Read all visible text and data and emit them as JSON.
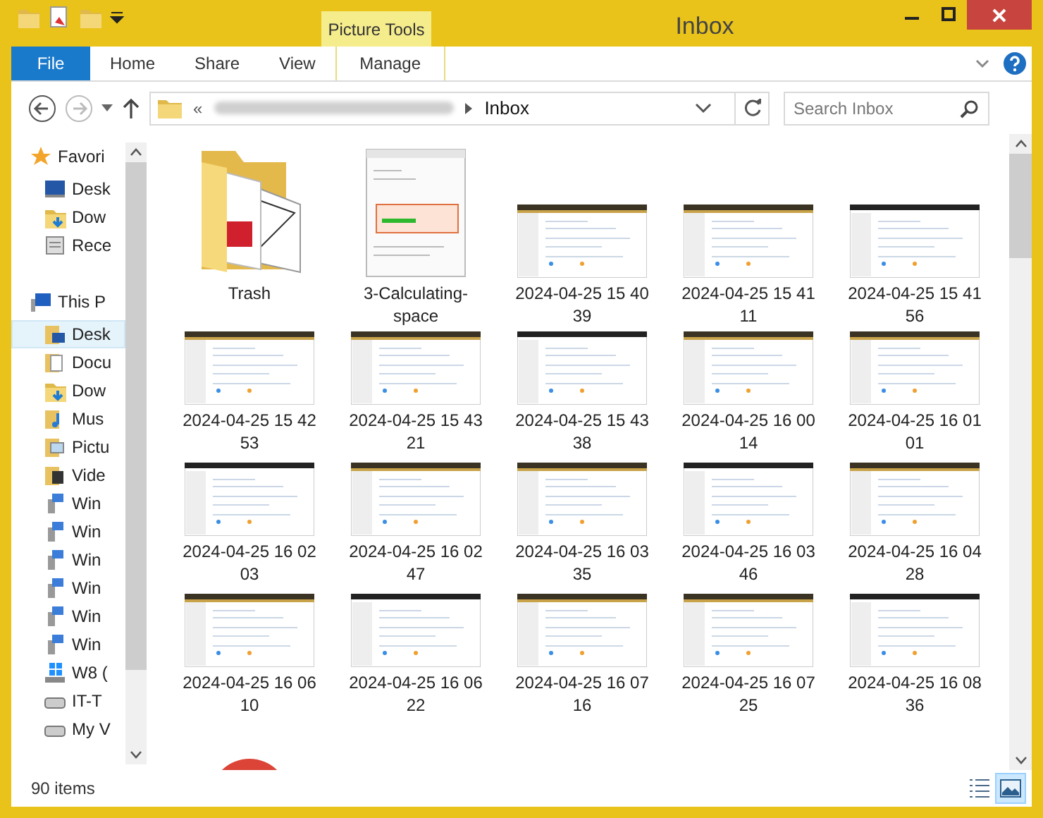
{
  "window": {
    "title": "Inbox",
    "context_tab": "Picture Tools"
  },
  "ribbon": {
    "tabs": [
      {
        "label": "File",
        "kind": "file",
        "selected": false
      },
      {
        "label": "Home",
        "kind": "tab",
        "selected": false
      },
      {
        "label": "Share",
        "kind": "tab",
        "selected": false
      },
      {
        "label": "View",
        "kind": "tab",
        "selected": false
      },
      {
        "label": "Manage",
        "kind": "context",
        "selected": false
      }
    ]
  },
  "address_bar": {
    "overflow": "«",
    "current": "Inbox"
  },
  "search": {
    "placeholder": "Search Inbox"
  },
  "nav_pane": {
    "items": [
      {
        "label": "Favori",
        "kind": "star",
        "group": true,
        "selected": false
      },
      {
        "label": "Desk",
        "kind": "desktop",
        "group": false,
        "selected": false
      },
      {
        "label": "Dow",
        "kind": "download",
        "group": false,
        "selected": false
      },
      {
        "label": "Rece",
        "kind": "recent",
        "group": false,
        "selected": false
      },
      {
        "label": "This P",
        "kind": "pc",
        "group": true,
        "selected": false
      },
      {
        "label": "Desk",
        "kind": "folder-desktop",
        "group": false,
        "selected": true
      },
      {
        "label": "Docu",
        "kind": "folder-doc",
        "group": false,
        "selected": false
      },
      {
        "label": "Dow",
        "kind": "download",
        "group": false,
        "selected": false
      },
      {
        "label": "Mus",
        "kind": "folder-music",
        "group": false,
        "selected": false
      },
      {
        "label": "Pictu",
        "kind": "folder-pic",
        "group": false,
        "selected": false
      },
      {
        "label": "Vide",
        "kind": "folder-video",
        "group": false,
        "selected": false
      },
      {
        "label": "Win",
        "kind": "netdrive",
        "group": false,
        "selected": false
      },
      {
        "label": "Win",
        "kind": "netdrive",
        "group": false,
        "selected": false
      },
      {
        "label": "Win",
        "kind": "netdrive",
        "group": false,
        "selected": false
      },
      {
        "label": "Win",
        "kind": "netdrive",
        "group": false,
        "selected": false
      },
      {
        "label": "Win",
        "kind": "netdrive",
        "group": false,
        "selected": false
      },
      {
        "label": "Win",
        "kind": "netdrive",
        "group": false,
        "selected": false
      },
      {
        "label": "W8 (",
        "kind": "windrive",
        "group": false,
        "selected": false
      },
      {
        "label": "IT-T",
        "kind": "drive",
        "group": false,
        "selected": false
      },
      {
        "label": "My V",
        "kind": "drive",
        "group": false,
        "selected": false
      }
    ]
  },
  "files": [
    {
      "label": "Trash",
      "kind": "folder"
    },
    {
      "label": "3-Calculating-space",
      "kind": "dialog"
    },
    {
      "label": "2024-04-25 15 40 39",
      "kind": "screenshot"
    },
    {
      "label": "2024-04-25 15 41 11",
      "kind": "screenshot"
    },
    {
      "label": "2024-04-25 15 41 56",
      "kind": "screenshot"
    },
    {
      "label": "2024-04-25 15 42 53",
      "kind": "screenshot"
    },
    {
      "label": "2024-04-25 15 43 21",
      "kind": "screenshot"
    },
    {
      "label": "2024-04-25 15 43 38",
      "kind": "screenshot"
    },
    {
      "label": "2024-04-25 16 00 14",
      "kind": "screenshot"
    },
    {
      "label": "2024-04-25 16 01 01",
      "kind": "screenshot"
    },
    {
      "label": "2024-04-25 16 02 03",
      "kind": "screenshot"
    },
    {
      "label": "2024-04-25 16 02 47",
      "kind": "screenshot"
    },
    {
      "label": "2024-04-25 16 03 35",
      "kind": "screenshot"
    },
    {
      "label": "2024-04-25 16 03 46",
      "kind": "screenshot"
    },
    {
      "label": "2024-04-25 16 04 28",
      "kind": "screenshot"
    },
    {
      "label": "2024-04-25 16 06 10",
      "kind": "screenshot"
    },
    {
      "label": "2024-04-25 16 06 22",
      "kind": "screenshot"
    },
    {
      "label": "2024-04-25 16 07 16",
      "kind": "screenshot"
    },
    {
      "label": "2024-04-25 16 07 25",
      "kind": "screenshot"
    },
    {
      "label": "2024-04-25 16 08 36",
      "kind": "screenshot"
    },
    {
      "kind": "round-logo"
    }
  ],
  "status_bar": {
    "count": "90 items",
    "view_buttons": [
      {
        "kind": "details",
        "selected": false
      },
      {
        "kind": "large-icons",
        "selected": true
      }
    ]
  }
}
